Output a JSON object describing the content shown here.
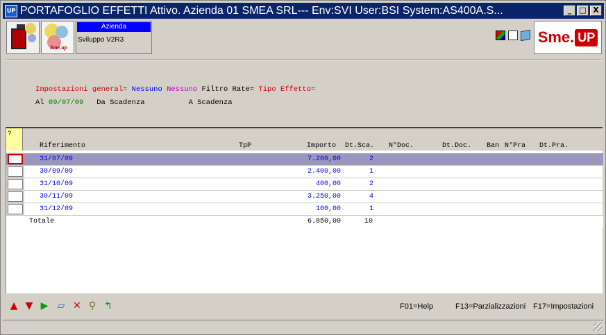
{
  "window": {
    "title": "PORTAFOGLIO EFFETTI Attivo.  Azienda 01 SMEA SRL--- Env:SVI User:BSI System:AS400A.S...",
    "app_icon_text": "UP",
    "minimize": "_",
    "maximize": "□",
    "close": "X"
  },
  "header": {
    "azienda_label": "Azienda",
    "azienda_value": "Sviluppo V2R3",
    "logo2_text": "Sme.up",
    "brand_sme": "Sme.",
    "brand_up": "UP"
  },
  "info": {
    "impostazioni_label": "Impostazioni general=",
    "impostazioni_value1": "Nessuno",
    "impostazioni_value2": "Nessuno",
    "filtro_label": "Filtro Rate=",
    "tipo_label": "Tipo Effetto=",
    "al_label": "Al",
    "al_value": "09/07/09",
    "da_scadenza": "Da Scadenza",
    "a_scadenza": "A Scadenza"
  },
  "grid": {
    "sel_header": "?",
    "columns": {
      "riferimento": "Riferimento",
      "tpp": "TpP",
      "importo": "Importo",
      "dt_sca": "Dt.Sca.",
      "n_doc": "N°Doc.",
      "dt_doc": "Dt.Doc.",
      "ban": "Ban",
      "n_pra": "N°Pra",
      "dt_pra": "Dt.Pra."
    },
    "rows": [
      {
        "riferimento": "31/07/09",
        "importo": "7.200,00",
        "dt_sca": "2"
      },
      {
        "riferimento": "30/09/09",
        "importo": "2.400,00",
        "dt_sca": "1"
      },
      {
        "riferimento": "31/10/09",
        "importo": "400,00",
        "dt_sca": "2"
      },
      {
        "riferimento": "30/11/09",
        "importo": "3.250,00",
        "dt_sca": "4"
      },
      {
        "riferimento": "31/12/09",
        "importo": "100,00",
        "dt_sca": "1"
      }
    ],
    "total": {
      "label": "Totale",
      "importo": "6.850,00",
      "dt_sca": "10"
    }
  },
  "toolbar": {
    "f01": "F01=Help",
    "f13": "F13=Parzializzazioni",
    "f17": "F17=Impostazioni"
  },
  "icons": {
    "up": "arrow-up-icon",
    "down": "arrow-down-icon",
    "play": "play-icon",
    "eraser": "eraser-icon",
    "delete": "close-icon",
    "search": "search-icon",
    "refresh": "refresh-icon"
  },
  "colors": {
    "titlebar": "#0a246a",
    "selected_row": "#9a96bc",
    "brand_red": "#cc0000",
    "value_blue": "#0000ff"
  }
}
